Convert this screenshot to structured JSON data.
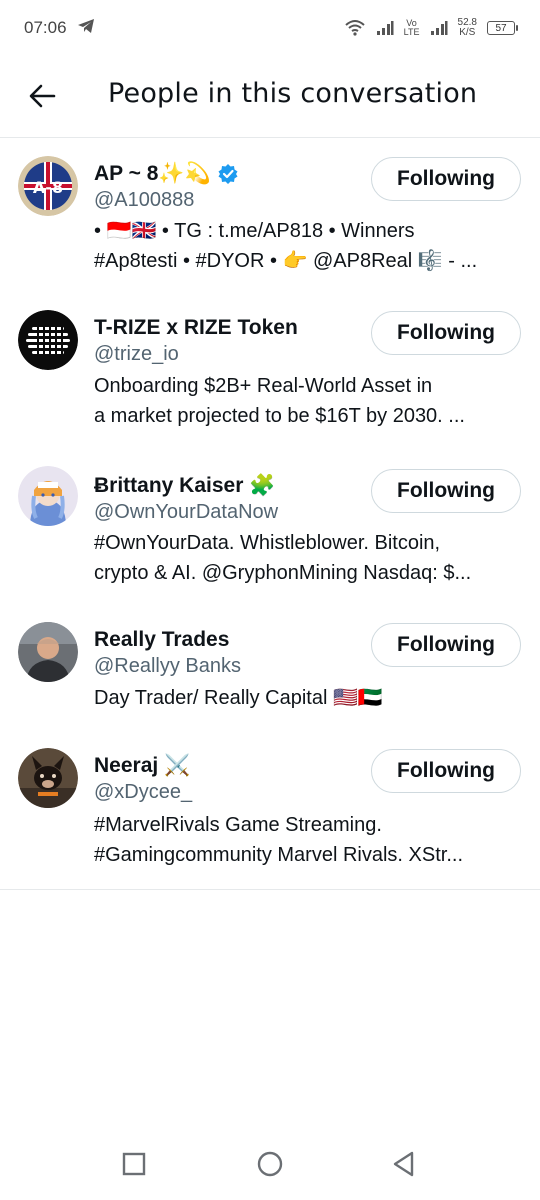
{
  "status_bar": {
    "time": "07:06",
    "network_label": "Vo LTE",
    "speed_value": "52.8",
    "speed_unit": "K/S",
    "battery": "57"
  },
  "header": {
    "title": "People in this conversation"
  },
  "users": [
    {
      "name": "AP ~ 8✨💫",
      "handle": "@A100888",
      "verified": true,
      "bio_line1": "• 🇮🇩🇬🇧 • TG : t.me/AP818 • Winners",
      "bio_line2": "#Ap8testi • #DYOR • 👉 @AP8Real 🎼 - ...",
      "button": "Following"
    },
    {
      "name": "T-RIZE x RIZE Token",
      "handle": "@trize_io",
      "verified": false,
      "bio_line1": "Onboarding $2B+ Real-World Asset in",
      "bio_line2": "a market projected to be $16T by 2030. ...",
      "button": "Following"
    },
    {
      "name": "Ƀrittany Kaiser 🧩",
      "handle": "@OwnYourDataNow",
      "verified": false,
      "bio_line1": "#OwnYourData. Whistleblower. Bitcoin,",
      "bio_line2": "crypto & AI. @GryphonMining Nasdaq: $...",
      "button": "Following"
    },
    {
      "name": "Really Trades",
      "handle": "@Reallyy Banks",
      "verified": false,
      "bio_line1": "Day Trader/ Really Capital 🇺🇸🇦🇪",
      "bio_line2": "",
      "button": "Following"
    },
    {
      "name": "Neeraj ⚔️",
      "handle": "@xDycee_",
      "verified": false,
      "bio_line1": "#MarvelRivals Game Streaming.",
      "bio_line2": "#Gamingcommunity Marvel Rivals. XStr...",
      "button": "Following"
    }
  ],
  "icons": {
    "back": "arrow-left-icon",
    "verified": "verified-badge-icon",
    "nav_recent": "square-icon",
    "nav_home": "circle-icon",
    "nav_back": "triangle-back-icon"
  },
  "colors": {
    "accent": "#1d9bf0",
    "text": "#0f1419",
    "secondary": "#536471",
    "border": "#cfd9de"
  }
}
